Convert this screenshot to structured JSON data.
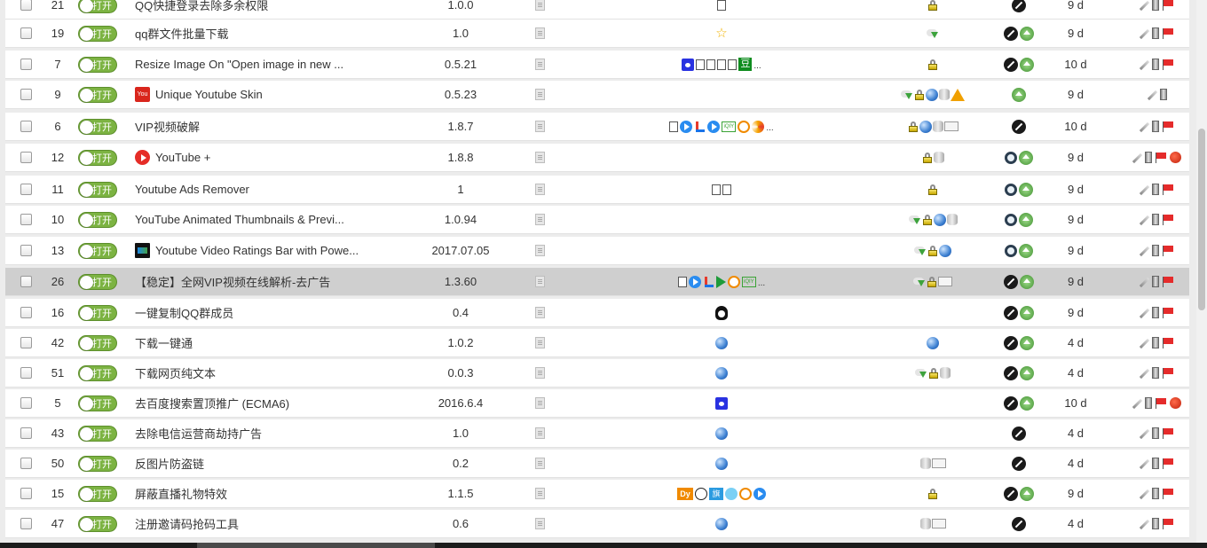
{
  "toggle_label": "打开",
  "colors": {
    "toggle_on": "#7cb342",
    "selected_row": "#cfcfcf",
    "row_bg": "#ffffff"
  },
  "rows": [
    {
      "pos": "21",
      "name": "QQ快捷登录去除多余权限",
      "version": "1.0.0",
      "updated": "9 d",
      "name_icon": "",
      "selected": false,
      "sites": [
        "doc-icon"
      ],
      "features": [
        "lock-icon"
      ],
      "homepage": [
        "bug-icon"
      ],
      "actions": [
        "edit-icon",
        "trash-icon",
        "flag-icon"
      ]
    },
    {
      "pos": "19",
      "name": "qq群文件批量下载",
      "version": "1.0",
      "updated": "9 d",
      "name_icon": "",
      "selected": false,
      "sites": [
        "star-icon"
      ],
      "features": [
        "download-icon"
      ],
      "homepage": [
        "bug-icon",
        "home-icon"
      ],
      "actions": [
        "edit-icon",
        "trash-icon",
        "flag-icon"
      ]
    },
    {
      "pos": "7",
      "name": "Resize Image On \"Open image in new ...",
      "version": "0.5.21",
      "updated": "10 d",
      "name_icon": "",
      "selected": false,
      "sites": [
        "baidu-icon",
        "doc-icon",
        "doc-icon",
        "doc-icon",
        "doc-icon",
        "douban-icon"
      ],
      "sites_more": true,
      "features": [
        "lock-icon"
      ],
      "homepage": [
        "bug-icon",
        "home-icon"
      ],
      "actions": [
        "edit-icon",
        "trash-icon",
        "flag-icon"
      ]
    },
    {
      "pos": "9",
      "name": "Unique Youtube Skin",
      "version": "0.5.23",
      "updated": "9 d",
      "name_icon": "youtube-skin-icon",
      "selected": false,
      "sites": [],
      "features": [
        "download-icon",
        "lock-icon",
        "globe-icon",
        "database-icon",
        "warning-icon"
      ],
      "homepage": [
        "home-icon"
      ],
      "actions": [
        "edit-icon",
        "trash-icon"
      ]
    },
    {
      "pos": "6",
      "name": "VIP视频破解",
      "version": "1.8.7",
      "updated": "10 d",
      "name_icon": "",
      "selected": false,
      "sites": [
        "doc-icon",
        "play-icon",
        "le-icon",
        "play-icon",
        "iqiyi-icon",
        "face-icon",
        "swirl-icon"
      ],
      "sites_more": true,
      "features": [
        "lock-icon",
        "globe-icon",
        "database-icon",
        "window-icon"
      ],
      "homepage": [
        "bug-icon"
      ],
      "actions": [
        "edit-icon",
        "trash-icon",
        "flag-icon"
      ]
    },
    {
      "pos": "12",
      "name": "YouTube +",
      "version": "1.8.8",
      "updated": "9 d",
      "name_icon": "youtube-plus-icon",
      "selected": false,
      "sites": [],
      "features": [
        "lock-icon",
        "database-icon"
      ],
      "homepage": [
        "ring-icon",
        "home-icon"
      ],
      "actions": [
        "edit-icon",
        "trash-icon",
        "flag-icon",
        "ladybug-icon"
      ]
    },
    {
      "pos": "11",
      "name": "Youtube Ads Remover",
      "version": "1",
      "updated": "9 d",
      "name_icon": "",
      "selected": false,
      "sites": [
        "doc-icon",
        "doc-icon"
      ],
      "features": [
        "lock-icon"
      ],
      "homepage": [
        "ring-icon",
        "home-icon"
      ],
      "actions": [
        "edit-icon",
        "trash-icon",
        "flag-icon"
      ]
    },
    {
      "pos": "10",
      "name": "YouTube Animated Thumbnails & Previ...",
      "version": "1.0.94",
      "updated": "9 d",
      "name_icon": "",
      "selected": false,
      "sites": [],
      "features": [
        "download-icon",
        "lock-icon",
        "globe-icon",
        "database-icon"
      ],
      "homepage": [
        "ring-icon",
        "home-icon"
      ],
      "actions": [
        "edit-icon",
        "trash-icon",
        "flag-icon"
      ]
    },
    {
      "pos": "13",
      "name": "Youtube Video Ratings Bar with Powe...",
      "version": "2017.07.05",
      "updated": "9 d",
      "name_icon": "ratings-bar-icon",
      "selected": false,
      "sites": [],
      "features": [
        "download-icon",
        "lock-icon",
        "globe-icon"
      ],
      "homepage": [
        "ring-icon",
        "home-icon"
      ],
      "actions": [
        "edit-icon",
        "trash-icon",
        "flag-icon"
      ]
    },
    {
      "pos": "26",
      "name": "【稳定】全网VIP视频在线解析-去广告",
      "version": "1.3.60",
      "updated": "9 d",
      "name_icon": "",
      "selected": true,
      "sites": [
        "doc-icon",
        "play-icon",
        "le-icon",
        "tri-icon",
        "face-icon",
        "iqiyi-icon"
      ],
      "sites_more": true,
      "features": [
        "download-icon",
        "lock-icon",
        "window-icon"
      ],
      "homepage": [
        "bug-icon",
        "home-icon"
      ],
      "actions": [
        "edit-icon",
        "trash-icon",
        "flag-icon"
      ]
    },
    {
      "pos": "16",
      "name": "一键复制QQ群成员",
      "version": "0.4",
      "updated": "9 d",
      "name_icon": "",
      "selected": false,
      "sites": [
        "penguin-icon"
      ],
      "features": [],
      "homepage": [
        "bug-icon",
        "home-icon"
      ],
      "actions": [
        "edit-icon",
        "trash-icon",
        "flag-icon"
      ]
    },
    {
      "pos": "42",
      "name": "下载一键通",
      "version": "1.0.2",
      "updated": "4 d",
      "name_icon": "",
      "selected": false,
      "sites": [
        "globe-icon"
      ],
      "features": [
        "globe-icon"
      ],
      "homepage": [
        "bug-icon",
        "home-icon"
      ],
      "actions": [
        "edit-icon",
        "trash-icon",
        "flag-icon"
      ]
    },
    {
      "pos": "51",
      "name": "下载网页纯文本",
      "version": "0.0.3",
      "updated": "4 d",
      "name_icon": "",
      "selected": false,
      "sites": [
        "globe-icon"
      ],
      "features": [
        "download-icon",
        "lock-icon",
        "database-icon"
      ],
      "homepage": [
        "bug-icon",
        "home-icon"
      ],
      "actions": [
        "edit-icon",
        "trash-icon",
        "flag-icon"
      ]
    },
    {
      "pos": "5",
      "name": "去百度搜索置顶推广 (ECMA6)",
      "version": "2016.6.4",
      "updated": "10 d",
      "name_icon": "",
      "selected": false,
      "sites": [
        "baidu-icon"
      ],
      "features": [],
      "homepage": [
        "bug-icon",
        "home-icon"
      ],
      "actions": [
        "edit-icon",
        "trash-icon",
        "flag-icon",
        "ladybug-icon"
      ]
    },
    {
      "pos": "43",
      "name": "去除电信运营商劫持广告",
      "version": "1.0",
      "updated": "4 d",
      "name_icon": "",
      "selected": false,
      "sites": [
        "globe-icon"
      ],
      "features": [],
      "homepage": [
        "bug-icon"
      ],
      "actions": [
        "edit-icon",
        "trash-icon",
        "flag-icon"
      ]
    },
    {
      "pos": "50",
      "name": "反图片防盗链",
      "version": "0.2",
      "updated": "4 d",
      "name_icon": "",
      "selected": false,
      "sites": [
        "globe-icon"
      ],
      "features": [
        "database-icon",
        "window-icon"
      ],
      "homepage": [
        "bug-icon"
      ],
      "actions": [
        "edit-icon",
        "trash-icon",
        "flag-icon"
      ]
    },
    {
      "pos": "15",
      "name": "屏蔽直播礼物特效",
      "version": "1.1.5",
      "updated": "9 d",
      "name_icon": "",
      "selected": false,
      "sites": [
        "douyu-icon",
        "panda-icon",
        "flagship-icon",
        "blue-icon",
        "orange-icon",
        "play-icon"
      ],
      "features": [
        "lock-icon"
      ],
      "homepage": [
        "bug-icon",
        "home-icon"
      ],
      "actions": [
        "edit-icon",
        "trash-icon",
        "flag-icon"
      ]
    },
    {
      "pos": "47",
      "name": "注册邀请码抢码工具",
      "version": "0.6",
      "updated": "4 d",
      "name_icon": "",
      "selected": false,
      "sites": [
        "globe-icon"
      ],
      "features": [
        "database-icon",
        "window-icon"
      ],
      "homepage": [
        "bug-icon"
      ],
      "actions": [
        "edit-icon",
        "trash-icon",
        "flag-icon"
      ]
    }
  ]
}
